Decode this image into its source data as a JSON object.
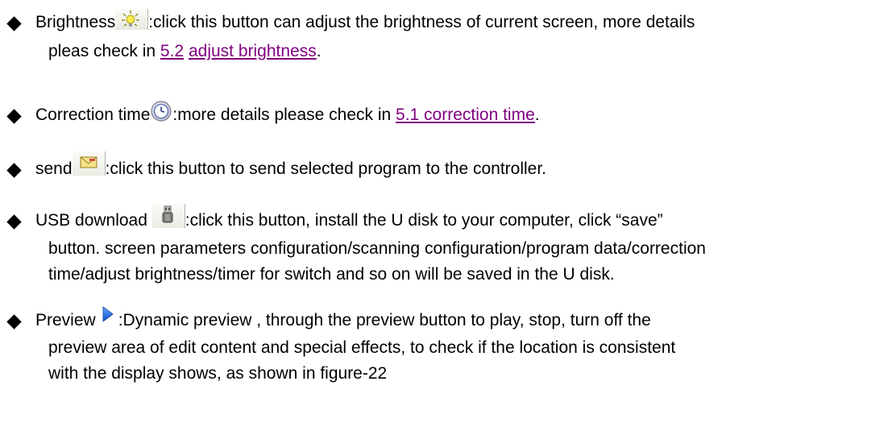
{
  "items": [
    {
      "label": "Brightness",
      "icon": "brightness-icon",
      "text_after_icon": ":click this button can adjust the brightness of current screen, more details",
      "cont_prefix": "pleas check in ",
      "link1": "5.2",
      "link_sep": " ",
      "link2": "adjust brightness",
      "cont_suffix": "."
    },
    {
      "label": "Correction time",
      "icon": "clock-icon",
      "text_after_icon": ":more details please check in ",
      "link": "5.1 correction time",
      "suffix": "."
    },
    {
      "label": "send",
      "icon": "send-mail-icon",
      "text_after_icon": ":click this button to send selected  program to the controller."
    },
    {
      "label": "USB download ",
      "icon": "usb-icon",
      "text_after_icon": ":click this button, install the U disk to your computer, click “save”",
      "lines": [
        "button. screen parameters configuration/scanning configuration/program data/correction",
        "time/adjust brightness/timer for switch and so on will be saved  in the U disk."
      ]
    },
    {
      "label": "Preview",
      "icon": "play-triangle-icon",
      "text_after_icon": ":Dynamic preview , through the preview button to play, stop, turn off the",
      "lines": [
        "preview area of edit content and special effects, to check if the location is consistent",
        "with the display shows, as shown in figure-22"
      ]
    }
  ],
  "colors": {
    "text": "#000000",
    "link": "#800080",
    "bullet": "#000000"
  }
}
